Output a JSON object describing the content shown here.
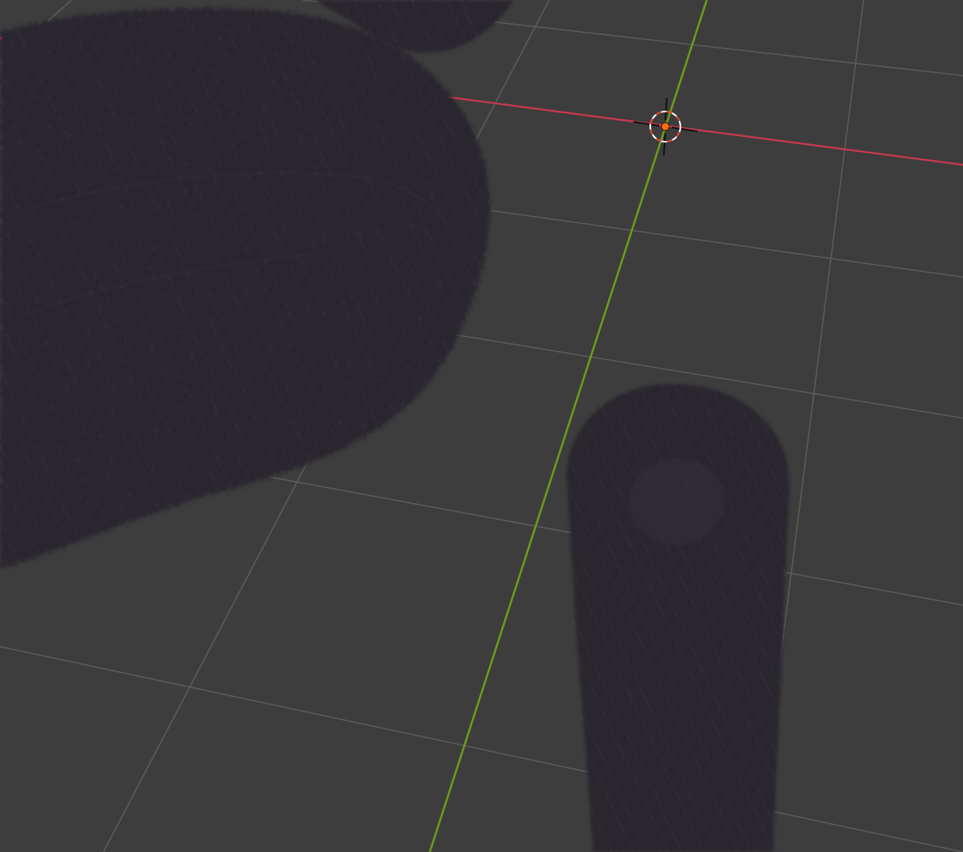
{
  "viewport": {
    "view_mode": "perspective",
    "shading": "solid"
  },
  "colors": {
    "background": "#3d3d3d",
    "grid_line": "#5b5b5b",
    "x_axis": "#c3394f",
    "y_axis": "#6e9a1c",
    "fur": "#29252e",
    "fur_highlight": "#3a3540",
    "cursor_ring_red": "#e94b35",
    "cursor_ring_white": "#ffffff",
    "cursor_dot": "#ff6a13"
  },
  "icons": {
    "cursor": "3d-cursor-icon"
  },
  "objects": [
    {
      "name": "fur-object-top-left",
      "kind": "fur-mesh"
    },
    {
      "name": "fur-object-top-small",
      "kind": "fur-mesh"
    },
    {
      "name": "fur-object-right",
      "kind": "fur-mesh"
    }
  ]
}
